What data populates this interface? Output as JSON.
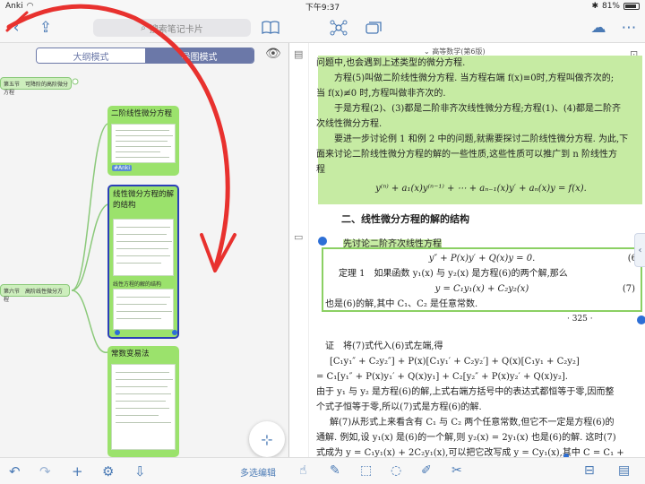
{
  "status": {
    "app": "Anki",
    "time": "下午9:37",
    "battery": "81%"
  },
  "toolbar": {
    "search_placeholder": "搜索笔记卡片"
  },
  "left": {
    "seg_left": "大纲模式",
    "seg_right": "导图模式",
    "node_section5": "第五节　可降阶的高阶微分方程",
    "node_section6": "第六节　高阶线性微分方程",
    "cards": [
      {
        "title": "二阶线性微分方程",
        "tag": "#Anki"
      },
      {
        "title": "线性微分方程的解的结构",
        "sub": "线性方程的解的结构"
      },
      {
        "title": "常数变易法"
      }
    ],
    "multi_edit": "多选编辑"
  },
  "right": {
    "doc_title": "高等数学(第6版)",
    "lines": [
      "问题中,也会遇到上述类型的微分方程.",
      "方程(5)叫做二阶线性微分方程. 当方程右端 f(x)≡0时,方程叫做齐次的;",
      "当 f(x)≢0 时,方程叫做非齐次的.",
      "于是方程(2)、(3)都是二阶非齐次线性微分方程;方程(1)、(4)都是二阶齐",
      "次线性微分方程.",
      "要进一步讨论例 1 和例 2 中的问题,就需要探讨二阶线性微分方程. 为此,下",
      "面来讨论二阶线性微分方程的解的一些性质,这些性质可以推广到 n 阶线性方",
      "程"
    ],
    "formula_n": "y⁽ⁿ⁾ + a₁(x)y⁽ⁿ⁻¹⁾ + ⋯ + aₙ₋₁(x)y′ + aₙ(x)y = f(x).",
    "section_heading": "二、线性微分方程的解的结构",
    "first_discuss": "先讨论二阶齐次线性方程",
    "eq6": "y″ + P(x)y′ + Q(x)y = 0.",
    "eq6_no": "(6",
    "theorem": "定理 1　如果函数 y₁(x) 与 y₂(x) 是方程(6)的两个解,那么",
    "eq7": "y = C₁y₁(x) + C₂y₂(x)",
    "eq7_no": "(7)",
    "also": "也是(6)的解,其中 C₁、C₂ 是任意常数.",
    "page_no": "· 325 ·",
    "proof_lines": [
      "证　将(7)式代入(6)式左端,得",
      "[C₁y₁″ + C₂y₂″] + P(x)[C₁y₁′ + C₂y₂′] + Q(x)[C₁y₁ + C₂y₂]",
      "= C₁[y₁″ + P(x)y₁′ + Q(x)y₁] + C₂[y₂″ + P(x)y₂′ + Q(x)y₂].",
      "由于 y₁ 与 y₂ 是方程(6)的解,上式右端方括号中的表达式都恒等于零,因而整",
      "个式子恒等于零,所以(7)式是方程(6)的解.",
      "解(7)从形式上来看含有 C₁ 与 C₂ 两个任意常数,但它不一定是方程(6)的",
      "通解. 例如,设 y₁(x) 是(6)的一个解,则 y₂(x) = 2y₁(x) 也是(6)的解. 这时(7)",
      "式成为 y = C₁y₁(x) + 2C₂y₁(x),可以把它改写成 y = Cy₁(x),其中 C = C₁ +"
    ]
  }
}
